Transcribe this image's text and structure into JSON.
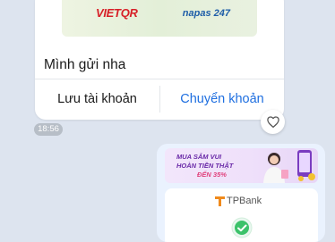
{
  "incoming_card": {
    "qr_brand": "VIETQR",
    "network_brand": "napas 247",
    "message": "Mình gửi nha",
    "save_account_label": "Lưu tài khoản",
    "transfer_label": "Chuyển khoản"
  },
  "timestamp": "18:56",
  "outgoing_card": {
    "banner_line1": "MUA SẮM VUI",
    "banner_line2": "HOÀN TIỀN THẬT",
    "banner_line3": "ĐẾN 35%",
    "bank_name": "TPBank"
  },
  "colors": {
    "chat_background": "#dde4ef",
    "accent_blue": "#1f6fe0",
    "tpbank_purple": "#6e2c8f",
    "success_green": "#3cc26a"
  }
}
